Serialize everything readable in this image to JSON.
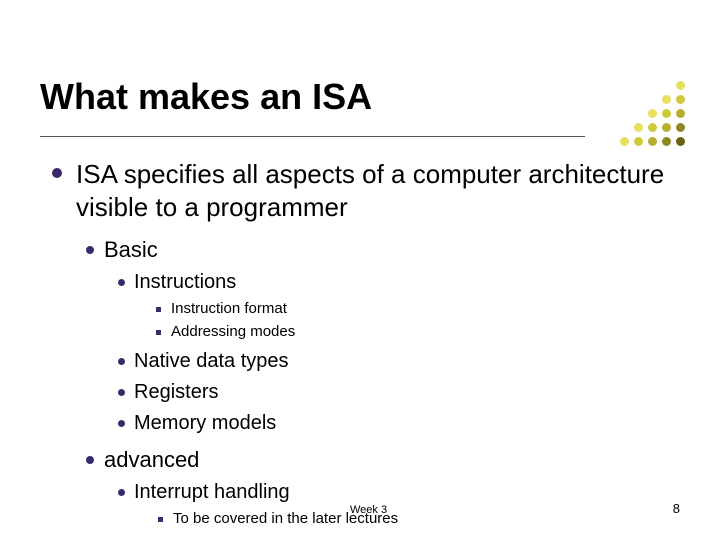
{
  "title": "What makes an ISA",
  "points": [
    {
      "text": "ISA specifies all aspects of a computer architecture visible to a programmer",
      "children": [
        {
          "text": "Basic",
          "children": [
            {
              "text": "Instructions",
              "children": [
                {
                  "text": "Instruction format"
                },
                {
                  "text": "Addressing modes"
                }
              ]
            },
            {
              "text": "Native data types"
            },
            {
              "text": "Registers"
            },
            {
              "text": "Memory models"
            }
          ]
        },
        {
          "text": "advanced",
          "children": [
            {
              "text": "Interrupt handling",
              "children": [
                {
                  "text": "To be covered in the later lectures"
                }
              ]
            }
          ]
        }
      ]
    }
  ],
  "footer": {
    "week": "Week 3",
    "page": "8"
  }
}
